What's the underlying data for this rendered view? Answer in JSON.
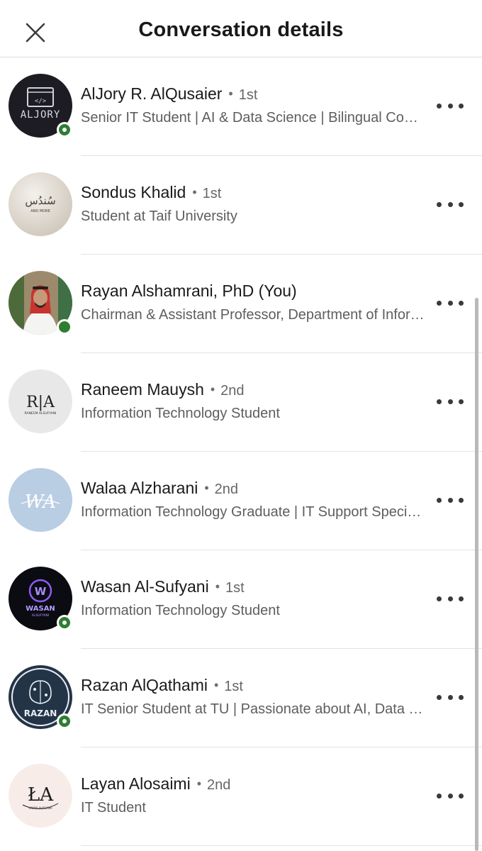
{
  "header": {
    "title": "Conversation details",
    "close_icon": "close-icon"
  },
  "participants": [
    {
      "name": "AlJory R. AlQusaier",
      "separator": "•",
      "degree": "1st",
      "headline": "Senior IT Student | AI & Data Science | Bilingual Communicator | Tech Enthusiast",
      "presence": "online",
      "avatar_text": "ALJORY",
      "avatar_bg": "#1c1c22"
    },
    {
      "name": "Sondus Khalid",
      "separator": "•",
      "degree": "1st",
      "headline": "Student at Taif University",
      "presence": "none",
      "avatar_text": "سُندُس",
      "avatar_sub": "AND MORE",
      "avatar_bg": "#e6e1da"
    },
    {
      "name": "Rayan Alshamrani, PhD (You)",
      "separator": "",
      "degree": "",
      "headline": "Chairman & Assistant Professor, Department of Information Technology",
      "presence": "active",
      "avatar_bg": "#8f7a5c"
    },
    {
      "name": "Raneem Mauysh",
      "separator": "•",
      "degree": "2nd",
      "headline": "Information Technology Student",
      "presence": "none",
      "avatar_text": "R|A",
      "avatar_sub": "RANEEM ALSUFYANI",
      "avatar_bg": "#e8e8e8"
    },
    {
      "name": "Walaa Alzharani",
      "separator": "•",
      "degree": "2nd",
      "headline": "Information Technology Graduate | IT Support Specialist",
      "presence": "none",
      "avatar_text": "WA",
      "avatar_bg": "#b9cde3"
    },
    {
      "name": "Wasan Al-Sufyani",
      "separator": "•",
      "degree": "1st",
      "headline": "Information Technology Student",
      "presence": "online",
      "avatar_text": "WASAN",
      "avatar_sub": "ALSUFYANI",
      "avatar_bg": "#0b0b12"
    },
    {
      "name": "Razan AlQathami",
      "separator": "•",
      "degree": "1st",
      "headline": "IT Senior Student at TU | Passionate about AI, Data Science",
      "presence": "online",
      "avatar_text": "RAZAN",
      "avatar_bg": "#243447"
    },
    {
      "name": "Layan Alosaimi",
      "separator": "•",
      "degree": "2nd",
      "headline": "IT Student",
      "presence": "none",
      "avatar_text": "ŁA",
      "avatar_sub": "LAYAN ALOSAIMI",
      "avatar_bg": "#f7ece8"
    }
  ],
  "colors": {
    "presence_green": "#2e7d32",
    "divider": "#e3e3e3",
    "headline_text": "#5e5e5e"
  }
}
